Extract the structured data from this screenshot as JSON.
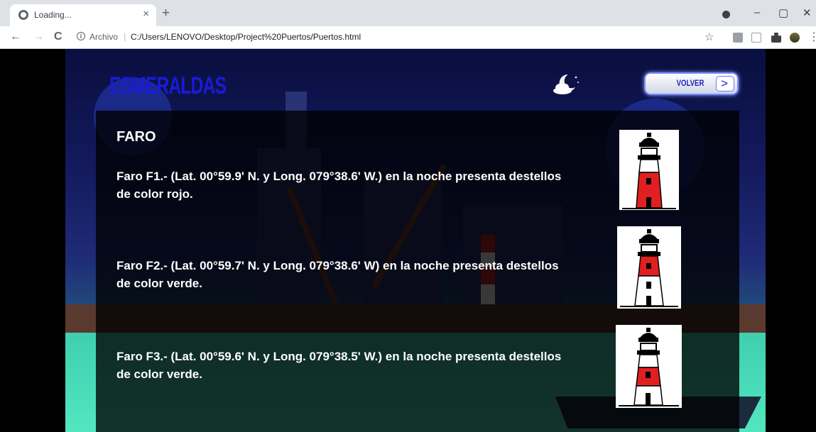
{
  "browser": {
    "tab_title": "Loading...",
    "tab_close": "×",
    "new_tab": "+",
    "window_controls": {
      "minimize": "–",
      "restore": "▢",
      "close": "✕"
    },
    "nav": {
      "back": "←",
      "forward": "→",
      "reload": "C"
    },
    "origin_label": "Archivo",
    "url_separator": "|",
    "url": "C:/Users/LENOVO/Desktop/Project%20Puertos/Puertos.html",
    "info_icon": "i",
    "star_icon": "☆",
    "menu_icon": "⋮",
    "extensions": [
      "qr-icon",
      "reader-icon",
      "puzzle-icon",
      "profile-extension-icon"
    ]
  },
  "page": {
    "title": "ESMERALDAS",
    "volver_label": "VOLVER",
    "volver_arrow": ">",
    "section_title": "FARO",
    "faros": [
      {
        "text": "Faro F1.- (Lat. 00°59.9' N. y Long. 079°38.6' W.) en la noche presenta destellos de color rojo."
      },
      {
        "text": "Faro F2.- (Lat. 00°59.7' N. y Long. 079°38.6' W) en la noche presenta destellos de color verde."
      },
      {
        "text": "Faro F3.- (Lat. 00°59.6' N. y Long. 079°38.5' W.) en la noche presenta destellos de color verde."
      }
    ]
  },
  "colors": {
    "title_blue": "#1a1ad8",
    "lighthouse_red": "#e02020"
  }
}
